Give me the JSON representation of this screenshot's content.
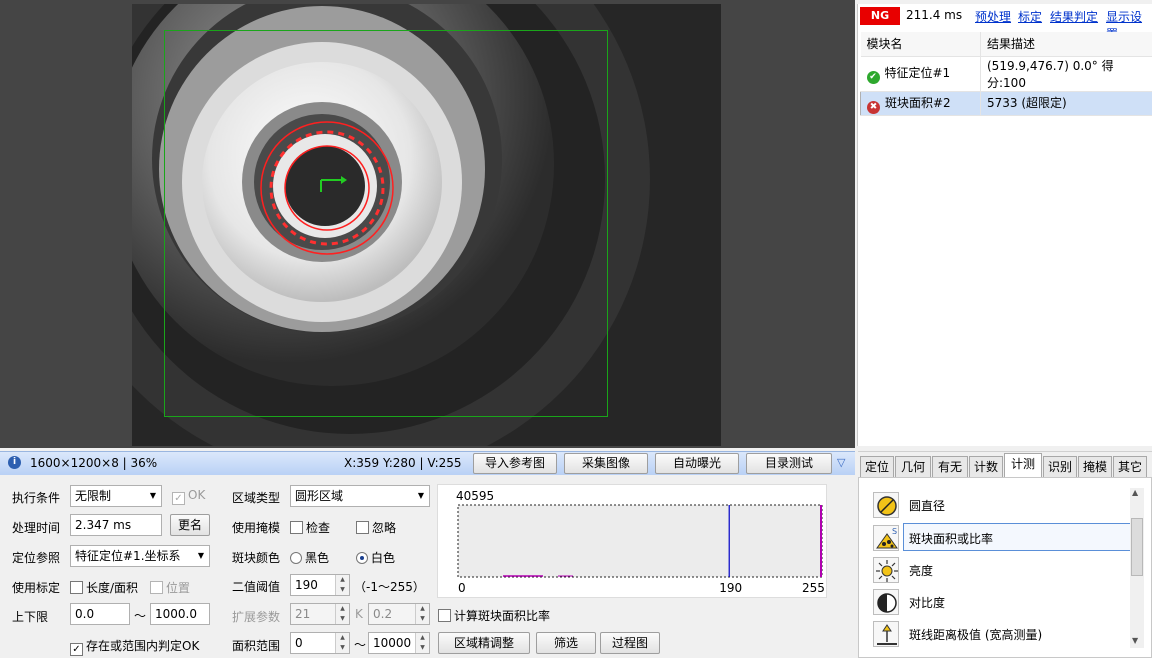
{
  "viewer": {
    "roi_color": "#1aa51a"
  },
  "result_panel": {
    "status": "NG",
    "time": "211.4 ms",
    "links": [
      "预处理",
      "标定",
      "结果判定",
      "显示设置"
    ],
    "columns": [
      "模块名",
      "结果描述"
    ],
    "rows": [
      {
        "name": "特征定位#1",
        "desc": "(519.9,476.7) 0.0° 得分:100",
        "status": "ok"
      },
      {
        "name": "斑块面积#2",
        "desc": "5733 (超限定)",
        "status": "ng"
      }
    ]
  },
  "status_bar": {
    "info": "1600×1200×8 | 36%",
    "coords": "X:359 Y:280 | V:255",
    "buttons": [
      "导入参考图",
      "采集图像",
      "自动曝光",
      "目录测试"
    ]
  },
  "params": {
    "exec_cond_label": "执行条件",
    "exec_cond_value": "无限制",
    "ok_label": "OK",
    "proc_time_label": "处理时间",
    "proc_time_value": "2.347 ms",
    "rename_label": "更名",
    "loc_ref_label": "定位参照",
    "loc_ref_value": "特征定位#1.坐标系",
    "use_calib_label": "使用标定",
    "len_area_label": "长度/面积",
    "position_label": "位置",
    "limits_label": "上下限",
    "lower_limit": "0.0",
    "tilde": "～",
    "upper_limit": "1000.0",
    "exist_ok_label": "存在或范围内判定OK",
    "region_type_label": "区域类型",
    "region_type_value": "圆形区域",
    "use_mask_label": "使用掩模",
    "check_label": "检查",
    "ignore_label": "忽略",
    "blob_color_label": "斑块颜色",
    "black_label": "黑色",
    "white_label": "白色",
    "threshold_label": "二值阈值",
    "threshold_value": "190",
    "threshold_range": "（-1～255）",
    "expand_label": "扩展参数",
    "expand_value": "21",
    "k_label": "K",
    "k_value": "0.2",
    "calc_ratio_label": "计算斑块面积比率",
    "area_range_label": "面积范围",
    "area_min": "0",
    "area_max": "10000",
    "btn_region_adjust": "区域精调整",
    "btn_filter": "筛选",
    "btn_process_img": "过程图"
  },
  "histogram": {
    "max_count": "40595",
    "ticks": [
      "0",
      "190",
      "255"
    ],
    "threshold": 190,
    "x_max": 255
  },
  "tool_tabs": [
    "定位",
    "几何",
    "有无",
    "计数",
    "计测",
    "识别",
    "掩模",
    "其它"
  ],
  "active_tab": "计测",
  "tools": [
    {
      "label": "圆直径",
      "icon": "circle-diameter-icon"
    },
    {
      "label": "斑块面积或比率",
      "icon": "blob-area-icon"
    },
    {
      "label": "亮度",
      "icon": "brightness-icon"
    },
    {
      "label": "对比度",
      "icon": "contrast-icon"
    },
    {
      "label": "斑线距离极值 (宽高测量)",
      "icon": "edge-distance-icon"
    }
  ]
}
